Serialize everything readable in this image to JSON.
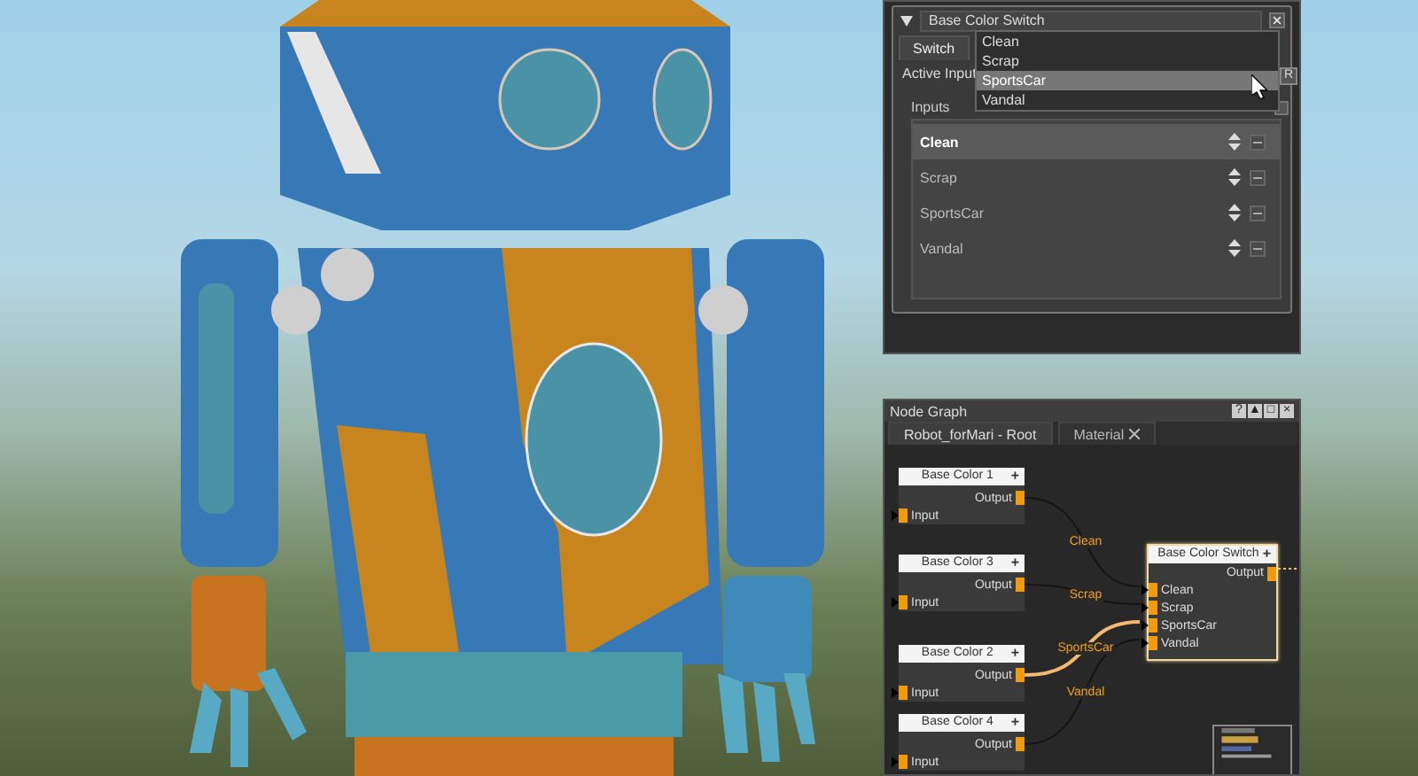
{
  "properties": {
    "title": "Base Color Switch",
    "expanded": true,
    "tabs": [
      {
        "label": "Switch",
        "selected": true
      }
    ],
    "active_input": {
      "label": "Active Input",
      "reset": "R",
      "open": true,
      "options": [
        {
          "label": "Clean",
          "selected": false
        },
        {
          "label": "Scrap",
          "selected": false
        },
        {
          "label": "SportsCar",
          "selected": true
        },
        {
          "label": "Vandal",
          "selected": false
        }
      ]
    },
    "inputs": {
      "label": "Inputs",
      "items": [
        {
          "name": "Clean",
          "selected": true
        },
        {
          "name": "Scrap",
          "selected": false
        },
        {
          "name": "SportsCar",
          "selected": false
        },
        {
          "name": "Vandal",
          "selected": false
        }
      ]
    }
  },
  "node_graph": {
    "title": "Node Graph",
    "header_buttons": [
      "?",
      "▲",
      "□",
      "×"
    ],
    "tabs": [
      {
        "label": "Robot_forMari - Root",
        "selected": true,
        "closable": false
      },
      {
        "label": "Material",
        "selected": false,
        "closable": true
      }
    ],
    "nodes": [
      {
        "title": "Base Color 1",
        "add": "+",
        "output": "Output",
        "input": "Input"
      },
      {
        "title": "Base Color 3",
        "add": "+",
        "output": "Output",
        "input": "Input"
      },
      {
        "title": "Base Color 2",
        "add": "+",
        "output": "Output",
        "input": "Input"
      },
      {
        "title": "Base Color 4",
        "add": "+",
        "output": "Output",
        "input": "Input"
      }
    ],
    "switch_node": {
      "title": "Base Color Switch",
      "add": "+",
      "output": "Output",
      "selected": true,
      "inputs": [
        "Clean",
        "Scrap",
        "SportsCar",
        "Vandal"
      ]
    },
    "wires": [
      {
        "label": "Clean",
        "active": false
      },
      {
        "label": "Scrap",
        "active": false
      },
      {
        "label": "SportsCar",
        "active": true
      },
      {
        "label": "Vandal",
        "active": false
      }
    ]
  }
}
